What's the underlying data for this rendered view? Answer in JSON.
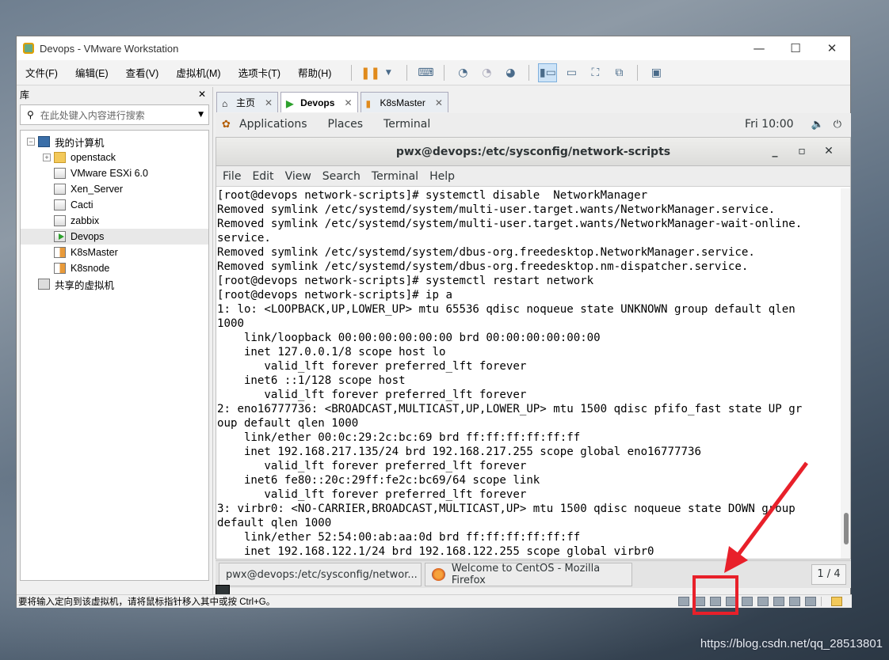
{
  "vmware": {
    "title": "Devops - VMware Workstation",
    "menu": [
      "文件(F)",
      "编辑(E)",
      "查看(V)",
      "虚拟机(M)",
      "选项卡(T)",
      "帮助(H)"
    ]
  },
  "library": {
    "title": "库",
    "search_placeholder": "在此处键入内容进行搜索",
    "root": "我的计算机",
    "items": [
      "openstack",
      "VMware ESXi 6.0",
      "Xen_Server",
      "Cacti",
      "zabbix",
      "Devops",
      "K8sMaster",
      "K8snode"
    ],
    "shared": "共享的虚拟机"
  },
  "tabs": [
    "主页",
    "Devops",
    "K8sMaster"
  ],
  "gnome": {
    "applications": "Applications",
    "places": "Places",
    "terminal": "Terminal",
    "clock": "Fri 10:00"
  },
  "terminal": {
    "title": "pwx@devops:/etc/sysconfig/network-scripts",
    "menu": [
      "File",
      "Edit",
      "View",
      "Search",
      "Terminal",
      "Help"
    ],
    "output": "[root@devops network-scripts]# systemctl disable  NetworkManager\nRemoved symlink /etc/systemd/system/multi-user.target.wants/NetworkManager.service.\nRemoved symlink /etc/systemd/system/multi-user.target.wants/NetworkManager-wait-online.\nservice.\nRemoved symlink /etc/systemd/system/dbus-org.freedesktop.NetworkManager.service.\nRemoved symlink /etc/systemd/system/dbus-org.freedesktop.nm-dispatcher.service.\n[root@devops network-scripts]# systemctl restart network\n[root@devops network-scripts]# ip a\n1: lo: <LOOPBACK,UP,LOWER_UP> mtu 65536 qdisc noqueue state UNKNOWN group default qlen\n1000\n    link/loopback 00:00:00:00:00:00 brd 00:00:00:00:00:00\n    inet 127.0.0.1/8 scope host lo\n       valid_lft forever preferred_lft forever\n    inet6 ::1/128 scope host\n       valid_lft forever preferred_lft forever\n2: eno16777736: <BROADCAST,MULTICAST,UP,LOWER_UP> mtu 1500 qdisc pfifo_fast state UP gr\noup default qlen 1000\n    link/ether 00:0c:29:2c:bc:69 brd ff:ff:ff:ff:ff:ff\n    inet 192.168.217.135/24 brd 192.168.217.255 scope global eno16777736\n       valid_lft forever preferred_lft forever\n    inet6 fe80::20c:29ff:fe2c:bc69/64 scope link\n       valid_lft forever preferred_lft forever\n3: virbr0: <NO-CARRIER,BROADCAST,MULTICAST,UP> mtu 1500 qdisc noqueue state DOWN group\ndefault qlen 1000\n    link/ether 52:54:00:ab:aa:0d brd ff:ff:ff:ff:ff:ff\n    inet 192.168.122.1/24 brd 192.168.122.255 scope global virbr0"
  },
  "taskbar": {
    "terminal_task": "pwx@devops:/etc/sysconfig/networ...",
    "firefox_task": "Welcome to CentOS - Mozilla Firefox",
    "pager": "1 / 4"
  },
  "status_text": "要将输入定向到该虚拟机，请将鼠标指针移入其中或按 Ctrl+G。",
  "watermark": "https://blog.csdn.net/qq_28513801",
  "colors": {
    "highlight": "#e8202a",
    "accent": "#3a6ea8"
  }
}
